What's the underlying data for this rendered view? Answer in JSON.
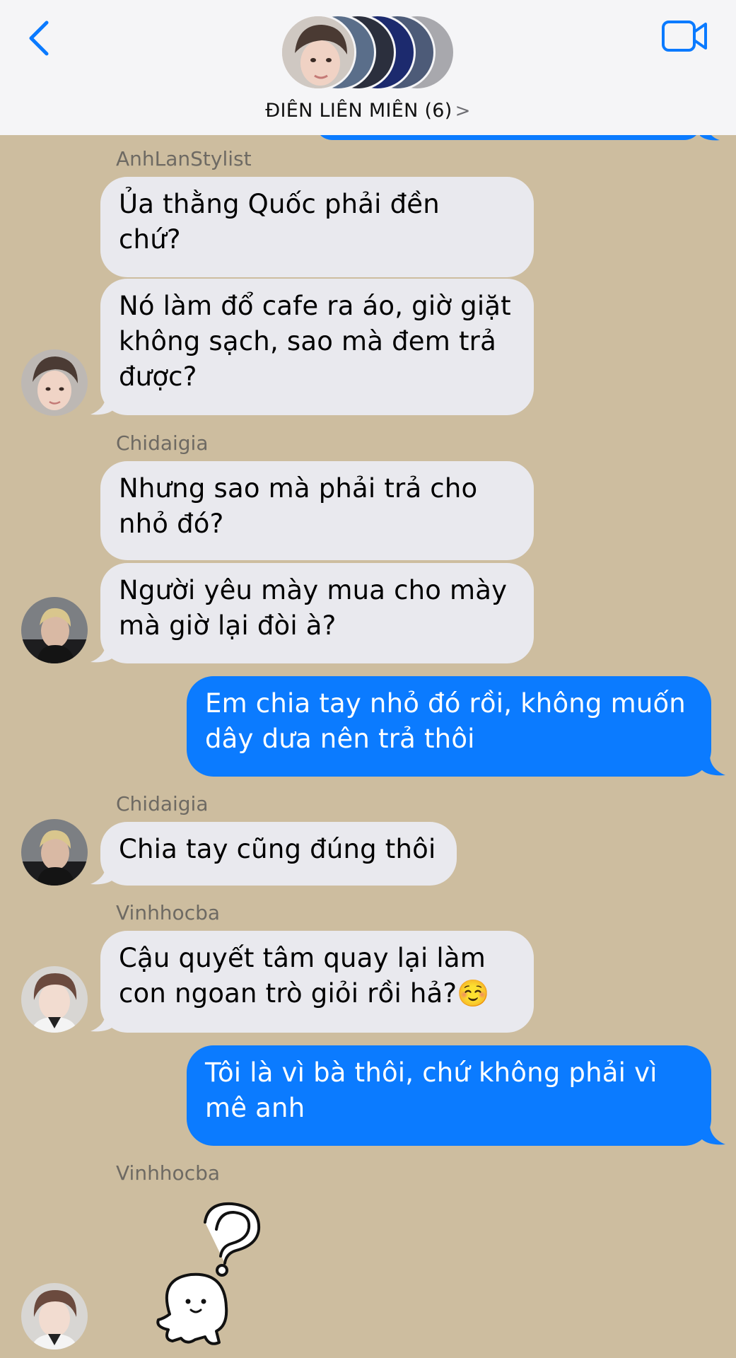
{
  "header": {
    "group_name": "ĐIÊN LIÊN MIÊN (6)",
    "chevron": ">"
  },
  "messages": [
    {
      "sender": "AnhLanStylist"
    },
    {
      "text": "Ủa thằng Quốc phải đền\nchứ?"
    },
    {
      "text": "Nó làm đổ cafe ra áo, giờ giặt\nkhông sạch, sao mà đem trả\nđược?"
    },
    {
      "sender": "Chidaigia"
    },
    {
      "text": "Nhưng sao mà phải trả cho\nnhỏ đó?"
    },
    {
      "text": "Người yêu mày mua cho mày\nmà giờ lại đòi à?"
    },
    {
      "text": "Em chia tay nhỏ đó rồi, không muốn\ndây dưa nên trả thôi"
    },
    {
      "sender": "Chidaigia"
    },
    {
      "text": "Chia tay cũng đúng thôi"
    },
    {
      "sender": "Vinhhocba"
    },
    {
      "text": "Cậu quyết tâm quay lại làm\ncon ngoan trò giỏi rồi hả?☺️"
    },
    {
      "text": "Tôi là vì bà thôi, chứ không phải vì\nmê anh"
    },
    {
      "sender": "Vinhhocba"
    }
  ],
  "colors": {
    "background": "#cdbd9f",
    "sent_bubble": "#0b7bff",
    "received_bubble": "#e9e9ee",
    "accent": "#0a7aff"
  },
  "icons": {
    "back": "chevron-left-icon",
    "video": "video-camera-icon",
    "sticker": "confused-ghost-sticker"
  }
}
